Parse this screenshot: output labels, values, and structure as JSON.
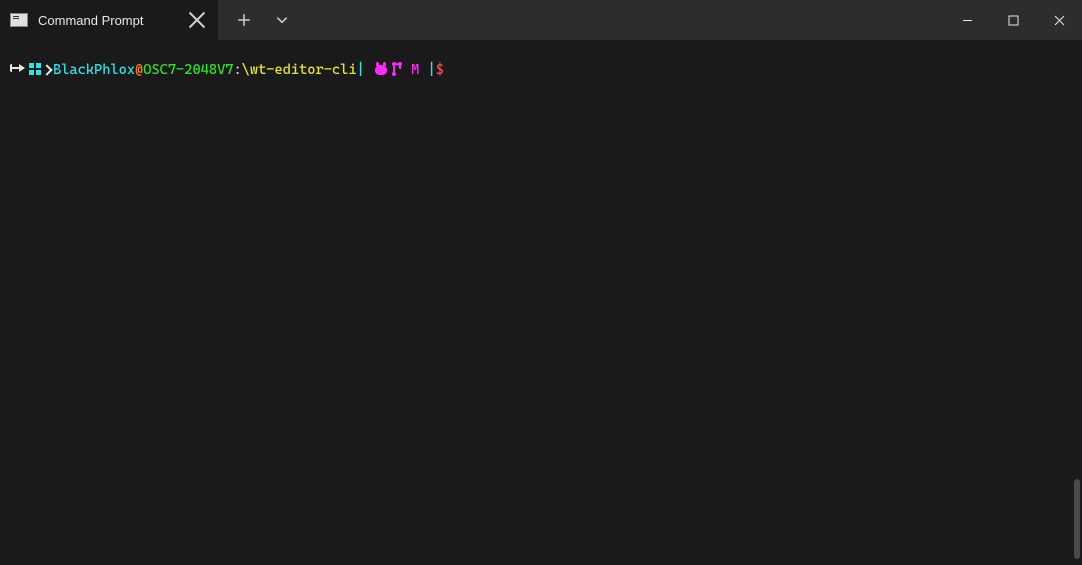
{
  "titlebar": {
    "tab": {
      "title": "Command Prompt"
    }
  },
  "prompt": {
    "user": "BlackPhlox",
    "at": "@",
    "host": "OSC7-2048V7",
    "sep1": ":",
    "path": "\\wt-editor-cli",
    "pipe1": "|",
    "branch_status": " M ",
    "pipe2": "|",
    "dollar": "$"
  }
}
